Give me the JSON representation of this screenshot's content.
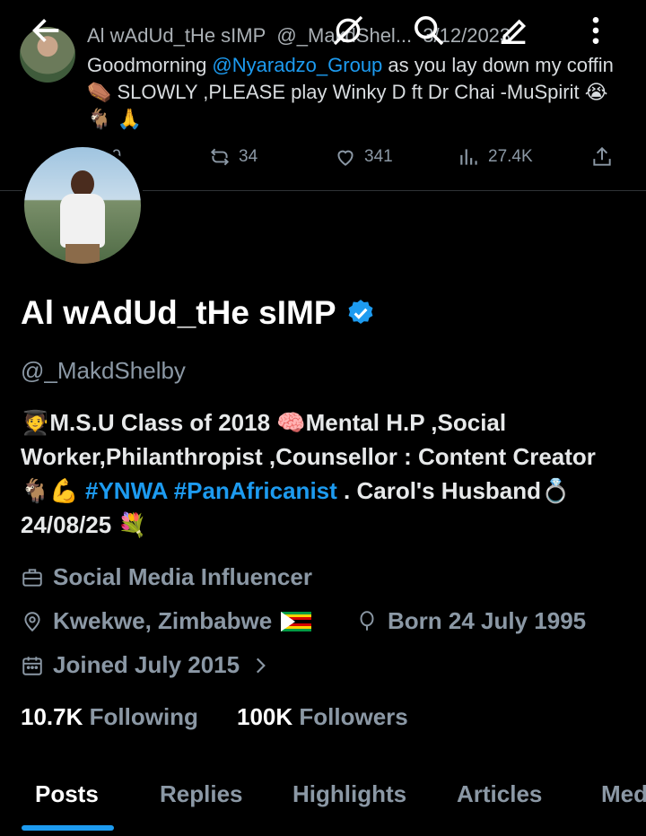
{
  "pinned_tweet": {
    "author_name": "Al wAdUd_tHe sIMP",
    "author_handle": "@_MakdShel...",
    "date": "3/12/2023",
    "text_before": "Goodmorning ",
    "mention": "@Nyaradzo_Group",
    "text_after": " as you lay down my coffin ⚰️ SLOWLY ,PLEASE play Winky D ft Dr Chai -MuSpirit 😭 🐐 🙏",
    "replies": "29",
    "retweets": "34",
    "likes": "341",
    "views": "27.4K"
  },
  "profile": {
    "display_name": "Al wAdUd_tHe sIMP",
    "handle": "@_MakdShelby",
    "bio_text": "🧑‍🎓M.S.U Class of 2018 🧠Mental H.P ,Social Worker,Philanthropist ,Counsellor : Content Creator 🐐💪 ",
    "bio_tag1": "#YNWA",
    "bio_tag2": "#PanAfricanist",
    "bio_tail": " . Carol's Husband💍24/08/25 💐",
    "category": "Social Media Influencer",
    "location": "Kwekwe, Zimbabwe",
    "birthday": "Born 24 July 1995",
    "joined": "Joined July 2015",
    "following_count": "10.7K",
    "following_label": "Following",
    "followers_count": "100K",
    "followers_label": "Followers"
  },
  "tabs": [
    "Posts",
    "Replies",
    "Highlights",
    "Articles",
    "Med"
  ],
  "active_tab": "Posts",
  "colors": {
    "accent": "#1d9bf0",
    "background": "#000000"
  },
  "icons": [
    "back-arrow-icon",
    "mute-icon",
    "search-icon",
    "edit-icon",
    "more-icon",
    "verified-badge-icon",
    "briefcase-icon",
    "location-pin-icon",
    "balloon-icon",
    "calendar-icon",
    "chevron-right-icon",
    "reply-icon",
    "retweet-icon",
    "like-icon",
    "views-icon",
    "share-icon"
  ]
}
